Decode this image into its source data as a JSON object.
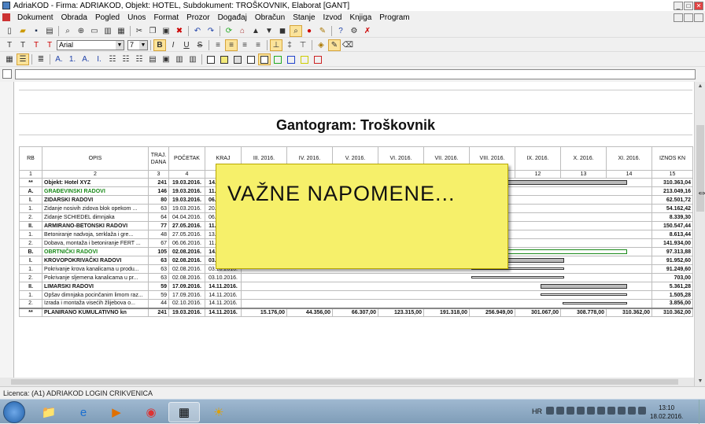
{
  "window": {
    "title": "AdriaKOD - Firma: ADRIAKOD,  Objekt: HOTEL,  Subdokument: TROŠKOVNIK,  Elaborat [GANT]",
    "min": "_",
    "max": "□",
    "close": "✕"
  },
  "menu": [
    "Dokument",
    "Obrada",
    "Pogled",
    "Unos",
    "Format",
    "Prozor",
    "Događaj",
    "Obračun",
    "Stanje",
    "Izvod",
    "Knjiga",
    "Program"
  ],
  "format_bar": {
    "font": "Arial",
    "size": "7"
  },
  "report": {
    "title": "Gantogram: Troškovnik",
    "headers": {
      "rb": "RB",
      "opis": "OPIS",
      "trajanje": "TRAJ. DANA",
      "pocetak": "POČETAK",
      "kraj": "KRAJ",
      "iznos": "IZNOS KN"
    },
    "months": [
      "III. 2016.",
      "IV. 2016.",
      "V. 2016.",
      "VI. 2016.",
      "VII. 2016.",
      "VIII. 2016.",
      "IX. 2016.",
      "X. 2016.",
      "XI. 2016."
    ],
    "col_numbers": [
      "1",
      "2",
      "3",
      "4",
      "5",
      "6",
      "7",
      "8",
      "9",
      "10",
      "11",
      "12",
      "13",
      "14",
      "15"
    ],
    "rows": [
      {
        "rb": "**",
        "opis": "Objekt: Hotel XYZ",
        "dana": "241",
        "pocetak": "19.03.2016.",
        "kraj": "14.11.2016.",
        "iznos": "310.363,04",
        "style": "bold"
      },
      {
        "rb": "A.",
        "opis": "GRAĐEVINSKI RADOVI",
        "dana": "146",
        "pocetak": "19.03.2016.",
        "kraj": "11.08.2016.",
        "iznos": "213.049,16",
        "style": "green"
      },
      {
        "rb": "I.",
        "opis": "ZIDARSKI RADOVI",
        "dana": "80",
        "pocetak": "19.03.2016.",
        "kraj": "06.06.2016.",
        "iznos": "62.501,72",
        "style": "bold"
      },
      {
        "rb": "1.",
        "opis": "Zidanje nosivih zidova blok opekom ...",
        "dana": "63",
        "pocetak": "19.03.2016.",
        "kraj": "20.05.2016.",
        "iznos": "54.162,42",
        "style": ""
      },
      {
        "rb": "2.",
        "opis": "Zidanje SCHIEDEL dimnjaka",
        "dana": "64",
        "pocetak": "04.04.2016.",
        "kraj": "06.06.2016.",
        "iznos": "8.339,30",
        "style": ""
      },
      {
        "rb": "II.",
        "opis": "ARMIRANO-BETONSKI RADOVI",
        "dana": "77",
        "pocetak": "27.05.2016.",
        "kraj": "11.08.2016.",
        "iznos": "150.547,44",
        "style": "bold"
      },
      {
        "rb": "1.",
        "opis": "Betoniranje nadvoja, serklaža i gre...",
        "dana": "48",
        "pocetak": "27.05.2016.",
        "kraj": "13.07.2016.",
        "iznos": "8.613,44",
        "style": ""
      },
      {
        "rb": "2.",
        "opis": "Dobava, montaža i betoniranje FERT ...",
        "dana": "67",
        "pocetak": "06.06.2016.",
        "kraj": "11.08.2016.",
        "iznos": "141.934,00",
        "style": ""
      },
      {
        "rb": "B.",
        "opis": "OBRTNIČKI RADOVI",
        "dana": "105",
        "pocetak": "02.08.2016.",
        "kraj": "14.11.2016.",
        "iznos": "97.313,88",
        "style": "green"
      },
      {
        "rb": "I.",
        "opis": "KROVOPOKRIVAČKI RADOVI",
        "dana": "63",
        "pocetak": "02.08.2016.",
        "kraj": "03.10.2016.",
        "iznos": "91.952,60",
        "style": "bold"
      },
      {
        "rb": "1.",
        "opis": "Pokrivanje krova kanalicama u produ...",
        "dana": "63",
        "pocetak": "02.08.2016.",
        "kraj": "03.10.2016.",
        "iznos": "91.249,60",
        "style": ""
      },
      {
        "rb": "2.",
        "opis": "Pokrivanje sljemena kanalicama u pr...",
        "dana": "63",
        "pocetak": "02.08.2016.",
        "kraj": "03.10.2016.",
        "iznos": "703,00",
        "style": ""
      },
      {
        "rb": "II.",
        "opis": "LIMARSKI RADOVI",
        "dana": "59",
        "pocetak": "17.09.2016.",
        "kraj": "14.11.2016.",
        "iznos": "5.361,28",
        "style": "bold"
      },
      {
        "rb": "1.",
        "opis": "Opšav dimnjaka pocinčanim limom raz...",
        "dana": "59",
        "pocetak": "17.09.2016.",
        "kraj": "14.11.2016.",
        "iznos": "1.505,28",
        "style": ""
      },
      {
        "rb": "2.",
        "opis": "Izrada i montaža visećih žlijebova o...",
        "dana": "44",
        "pocetak": "02.10.2016.",
        "kraj": "14.11.2016.",
        "iznos": "3.856,00",
        "style": ""
      }
    ],
    "total": {
      "rb": "**",
      "opis": "PLANIRANO KUMULATIVNO kn",
      "dana": "241",
      "pocetak": "19.03.2016.",
      "kraj": "14.11.2016.",
      "monthly": [
        "15.176,00",
        "44.356,00",
        "66.307,00",
        "123.315,00",
        "191.318,00",
        "256.949,00",
        "301.067,00",
        "308.778,00",
        "310.362,00"
      ],
      "iznos": "310.362,00"
    }
  },
  "note": "VAŽNE NAPOMENE...",
  "status": "Licenca: (A1) ADRIAKOD LOGIN CRIKVENICA",
  "tray": {
    "lang": "HR",
    "time": "13:10",
    "date": "18.02.2016."
  }
}
